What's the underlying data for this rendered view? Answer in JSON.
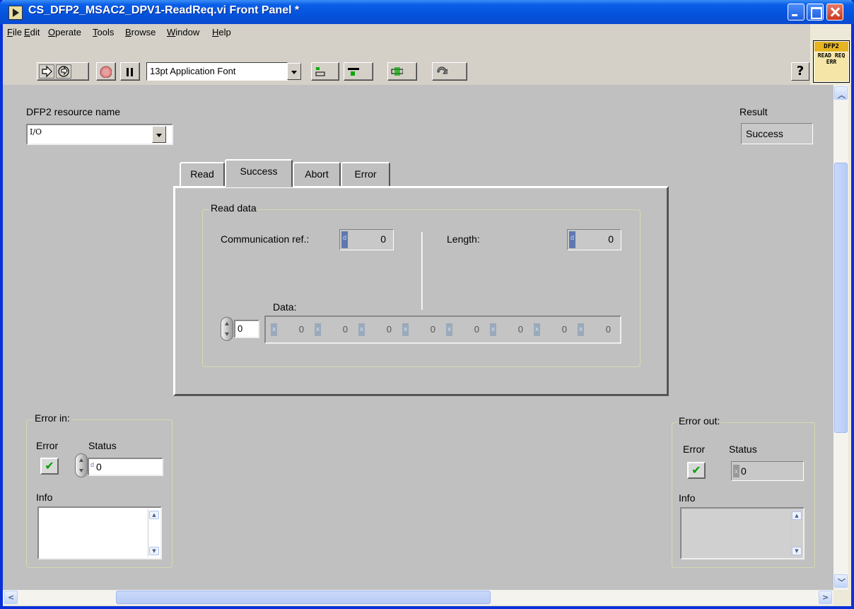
{
  "window": {
    "title": "CS_DFP2_MSAC2_DPV1-ReadReq.vi Front Panel *"
  },
  "menu": [
    "File",
    "Edit",
    "Operate",
    "Tools",
    "Browse",
    "Window",
    "Help"
  ],
  "toolbar": {
    "font": "13pt Application Font",
    "help": "?"
  },
  "vi_icon": {
    "top": "DFP2",
    "body": "READ REQ ERR"
  },
  "panel": {
    "resource_label": "DFP2 resource name",
    "resource_prefix": "I/O",
    "resource_value": "",
    "result_label": "Result",
    "result_value": "Success",
    "tabs": [
      "Read",
      "Success",
      "Abort",
      "Error"
    ],
    "active_tab": "Success",
    "read_data": {
      "group_label": "Read data",
      "comm_ref_label": "Communication ref.:",
      "comm_ref_value": "0",
      "length_label": "Length:",
      "length_value": "0",
      "data_label": "Data:",
      "data_index": "0",
      "data_values": [
        "0",
        "0",
        "0",
        "0",
        "0",
        "0",
        "0",
        "0"
      ]
    },
    "error_in": {
      "label": "Error in:",
      "error_label": "Error",
      "status_label": "Status",
      "status_value": "0",
      "info_label": "Info"
    },
    "error_out": {
      "label": "Error out:",
      "error_label": "Error",
      "status_label": "Status",
      "status_value": "0",
      "info_label": "Info"
    },
    "tag_d": "d",
    "tag_x": "x",
    "check_glyph": "✔"
  },
  "colors": {
    "titlebar": "#0a5ee8",
    "panel": "#c0c0c0",
    "check": "#00a000"
  }
}
